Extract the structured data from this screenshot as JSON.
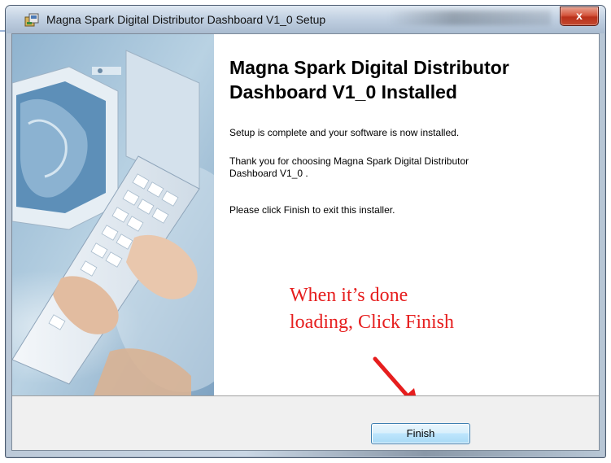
{
  "window": {
    "title": "Magna Spark Digital Distributor Dashboard V1_0 Setup",
    "close_glyph": "x",
    "app_icon": "setup-installer-icon"
  },
  "banner": {
    "image": "computer-keyboard-hands-illustration"
  },
  "content": {
    "heading_line1": "Magna Spark Digital Distributor",
    "heading_line2": "Dashboard V1_0 Installed",
    "para1": "Setup is complete and your software is now installed.",
    "para2_line1": "Thank you for choosing Magna Spark Digital Distributor",
    "para2_line2": "Dashboard V1_0 .",
    "para3": "Please click Finish to exit this installer."
  },
  "annotation": {
    "line1": "When it’s done",
    "line2": "loading, Click Finish",
    "color": "#e61e1e"
  },
  "buttons": {
    "finish": "Finish"
  }
}
